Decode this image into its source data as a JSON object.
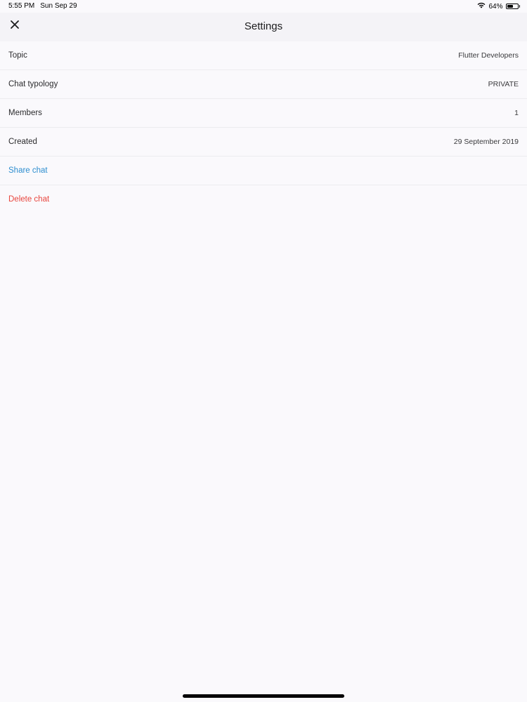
{
  "status_bar": {
    "time": "5:55 PM",
    "date": "Sun Sep 29",
    "battery_percent": "64%",
    "battery_level": 0.64
  },
  "nav": {
    "title": "Settings",
    "close_icon": "close-icon"
  },
  "details": [
    {
      "label": "Topic",
      "value": "Flutter Developers"
    },
    {
      "label": "Chat typology",
      "value": "PRIVATE"
    },
    {
      "label": "Members",
      "value": "1"
    },
    {
      "label": "Created",
      "value": "29 September 2019"
    }
  ],
  "actions": {
    "share_label": "Share chat",
    "delete_label": "Delete chat"
  },
  "colors": {
    "share": "#2d8ecf",
    "delete": "#e8463e",
    "background": "#faf9fc"
  }
}
